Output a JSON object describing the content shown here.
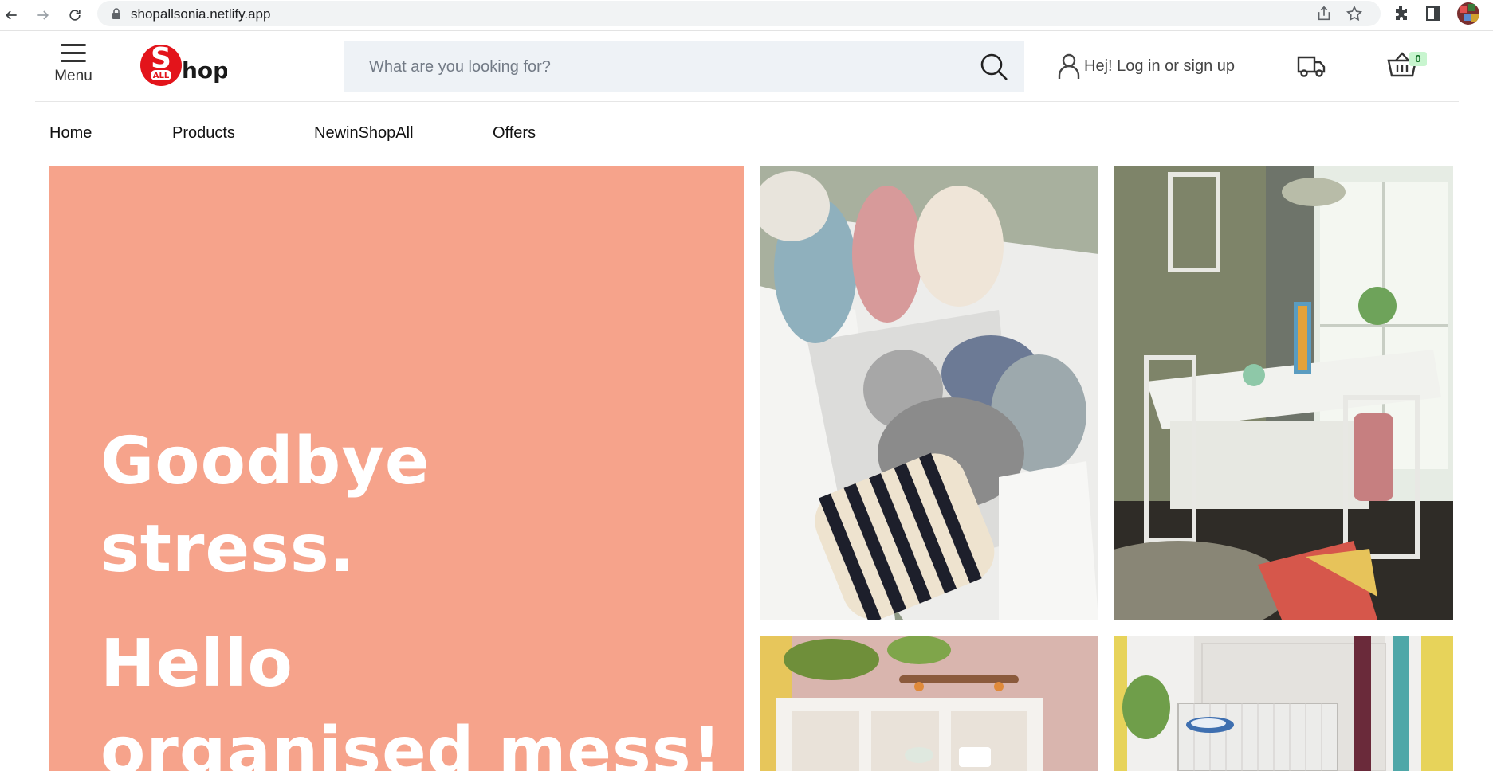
{
  "browser": {
    "url": "shopallsonia.netlify.app"
  },
  "header": {
    "menu_label": "Menu",
    "logo": {
      "letter": "S",
      "sub": "ALL",
      "rest": "hop"
    },
    "search_placeholder": "What are you looking for?",
    "login_text": "Hej! Log in or sign up",
    "cart_count": "0"
  },
  "nav": {
    "items": [
      {
        "label": "Home"
      },
      {
        "label": "Products"
      },
      {
        "label": "NewinShopAll"
      },
      {
        "label": "Offers"
      }
    ]
  },
  "hero": {
    "line1": "Goodbye",
    "line2": "stress.",
    "line3": "Hello",
    "line4": "organised mess!",
    "background": "#f6a38b"
  },
  "tiles": [
    {
      "icon": "storage-box-socks-image"
    },
    {
      "icon": "folding-dining-table-image"
    },
    {
      "icon": "shelving-unit-image"
    },
    {
      "icon": "mesh-storage-basket-image"
    }
  ]
}
